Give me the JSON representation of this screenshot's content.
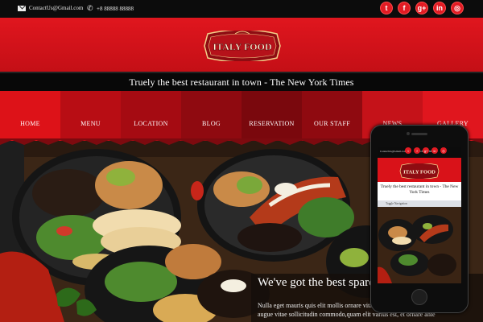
{
  "topbar": {
    "email": "ContactUs@Gmail.com",
    "phone": "+8 88888 88888",
    "socials": [
      {
        "icon": "twitter-icon",
        "glyph": "t"
      },
      {
        "icon": "facebook-icon",
        "glyph": "f"
      },
      {
        "icon": "google-plus-icon",
        "glyph": "g+"
      },
      {
        "icon": "linkedin-icon",
        "glyph": "in"
      },
      {
        "icon": "instagram-icon",
        "glyph": "◎"
      }
    ]
  },
  "logo": {
    "text": "ITALY FOOD"
  },
  "tagline": "Truely the best restaurant in town - The New York Times",
  "nav": [
    "HOME",
    "MENU",
    "LOCATION",
    "BLOG",
    "RESERVATION",
    "OUR STAFF",
    "NEWS",
    "GALLERY"
  ],
  "hero": {
    "title": "We've got the best spareri",
    "text": "Nulla eget mauris quis elit mollis ornare vitae ut odio. Cras tincidunt, augue vitae sollicitudin commodo,quam elit varius est, et ornare ante"
  },
  "mobile": {
    "email": "ContactUs@Gmail.com",
    "phone": "+8 88888 88888",
    "logo": "ITALY FOOD",
    "tagline": "Truely the best restaurant in town - The New York Times",
    "toggle": "Toggle Navigation"
  },
  "colors": {
    "brand_red": "#e21b23",
    "dark": "#0c0c0c"
  }
}
